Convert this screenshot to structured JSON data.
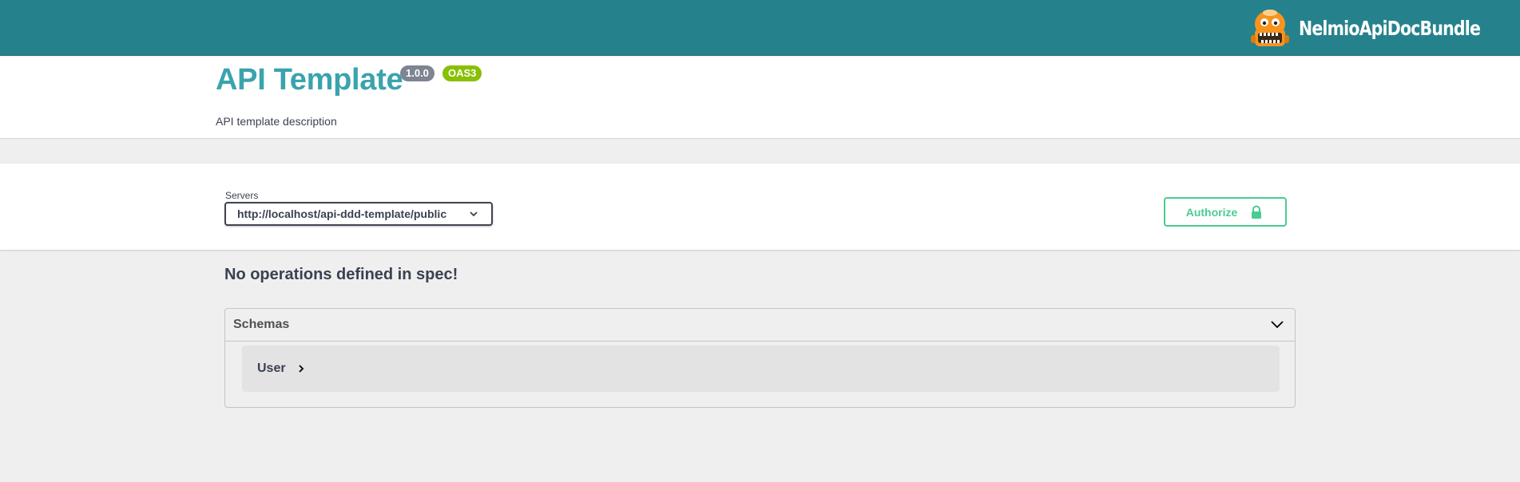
{
  "topbar": {
    "brand_name": "NelmioApiDocBundle",
    "logo_icon": "nelmio-mascot-icon",
    "color": "#25828d"
  },
  "info": {
    "title": "API Template",
    "version_badge": "1.0.0",
    "oas_badge": "OAS3",
    "description": "API template description"
  },
  "servers": {
    "label": "Servers",
    "selected": "http://localhost/api-ddd-template/public",
    "icon": "chevron-down-icon"
  },
  "authorize": {
    "label": "Authorize",
    "icon": "lock-icon",
    "color": "#49cc90"
  },
  "operations": {
    "empty_message": "No operations defined in spec!"
  },
  "schemas": {
    "title": "Schemas",
    "toggle_icon": "chevron-down-icon",
    "items": [
      {
        "name": "User",
        "icon": "chevron-right-icon"
      }
    ]
  }
}
